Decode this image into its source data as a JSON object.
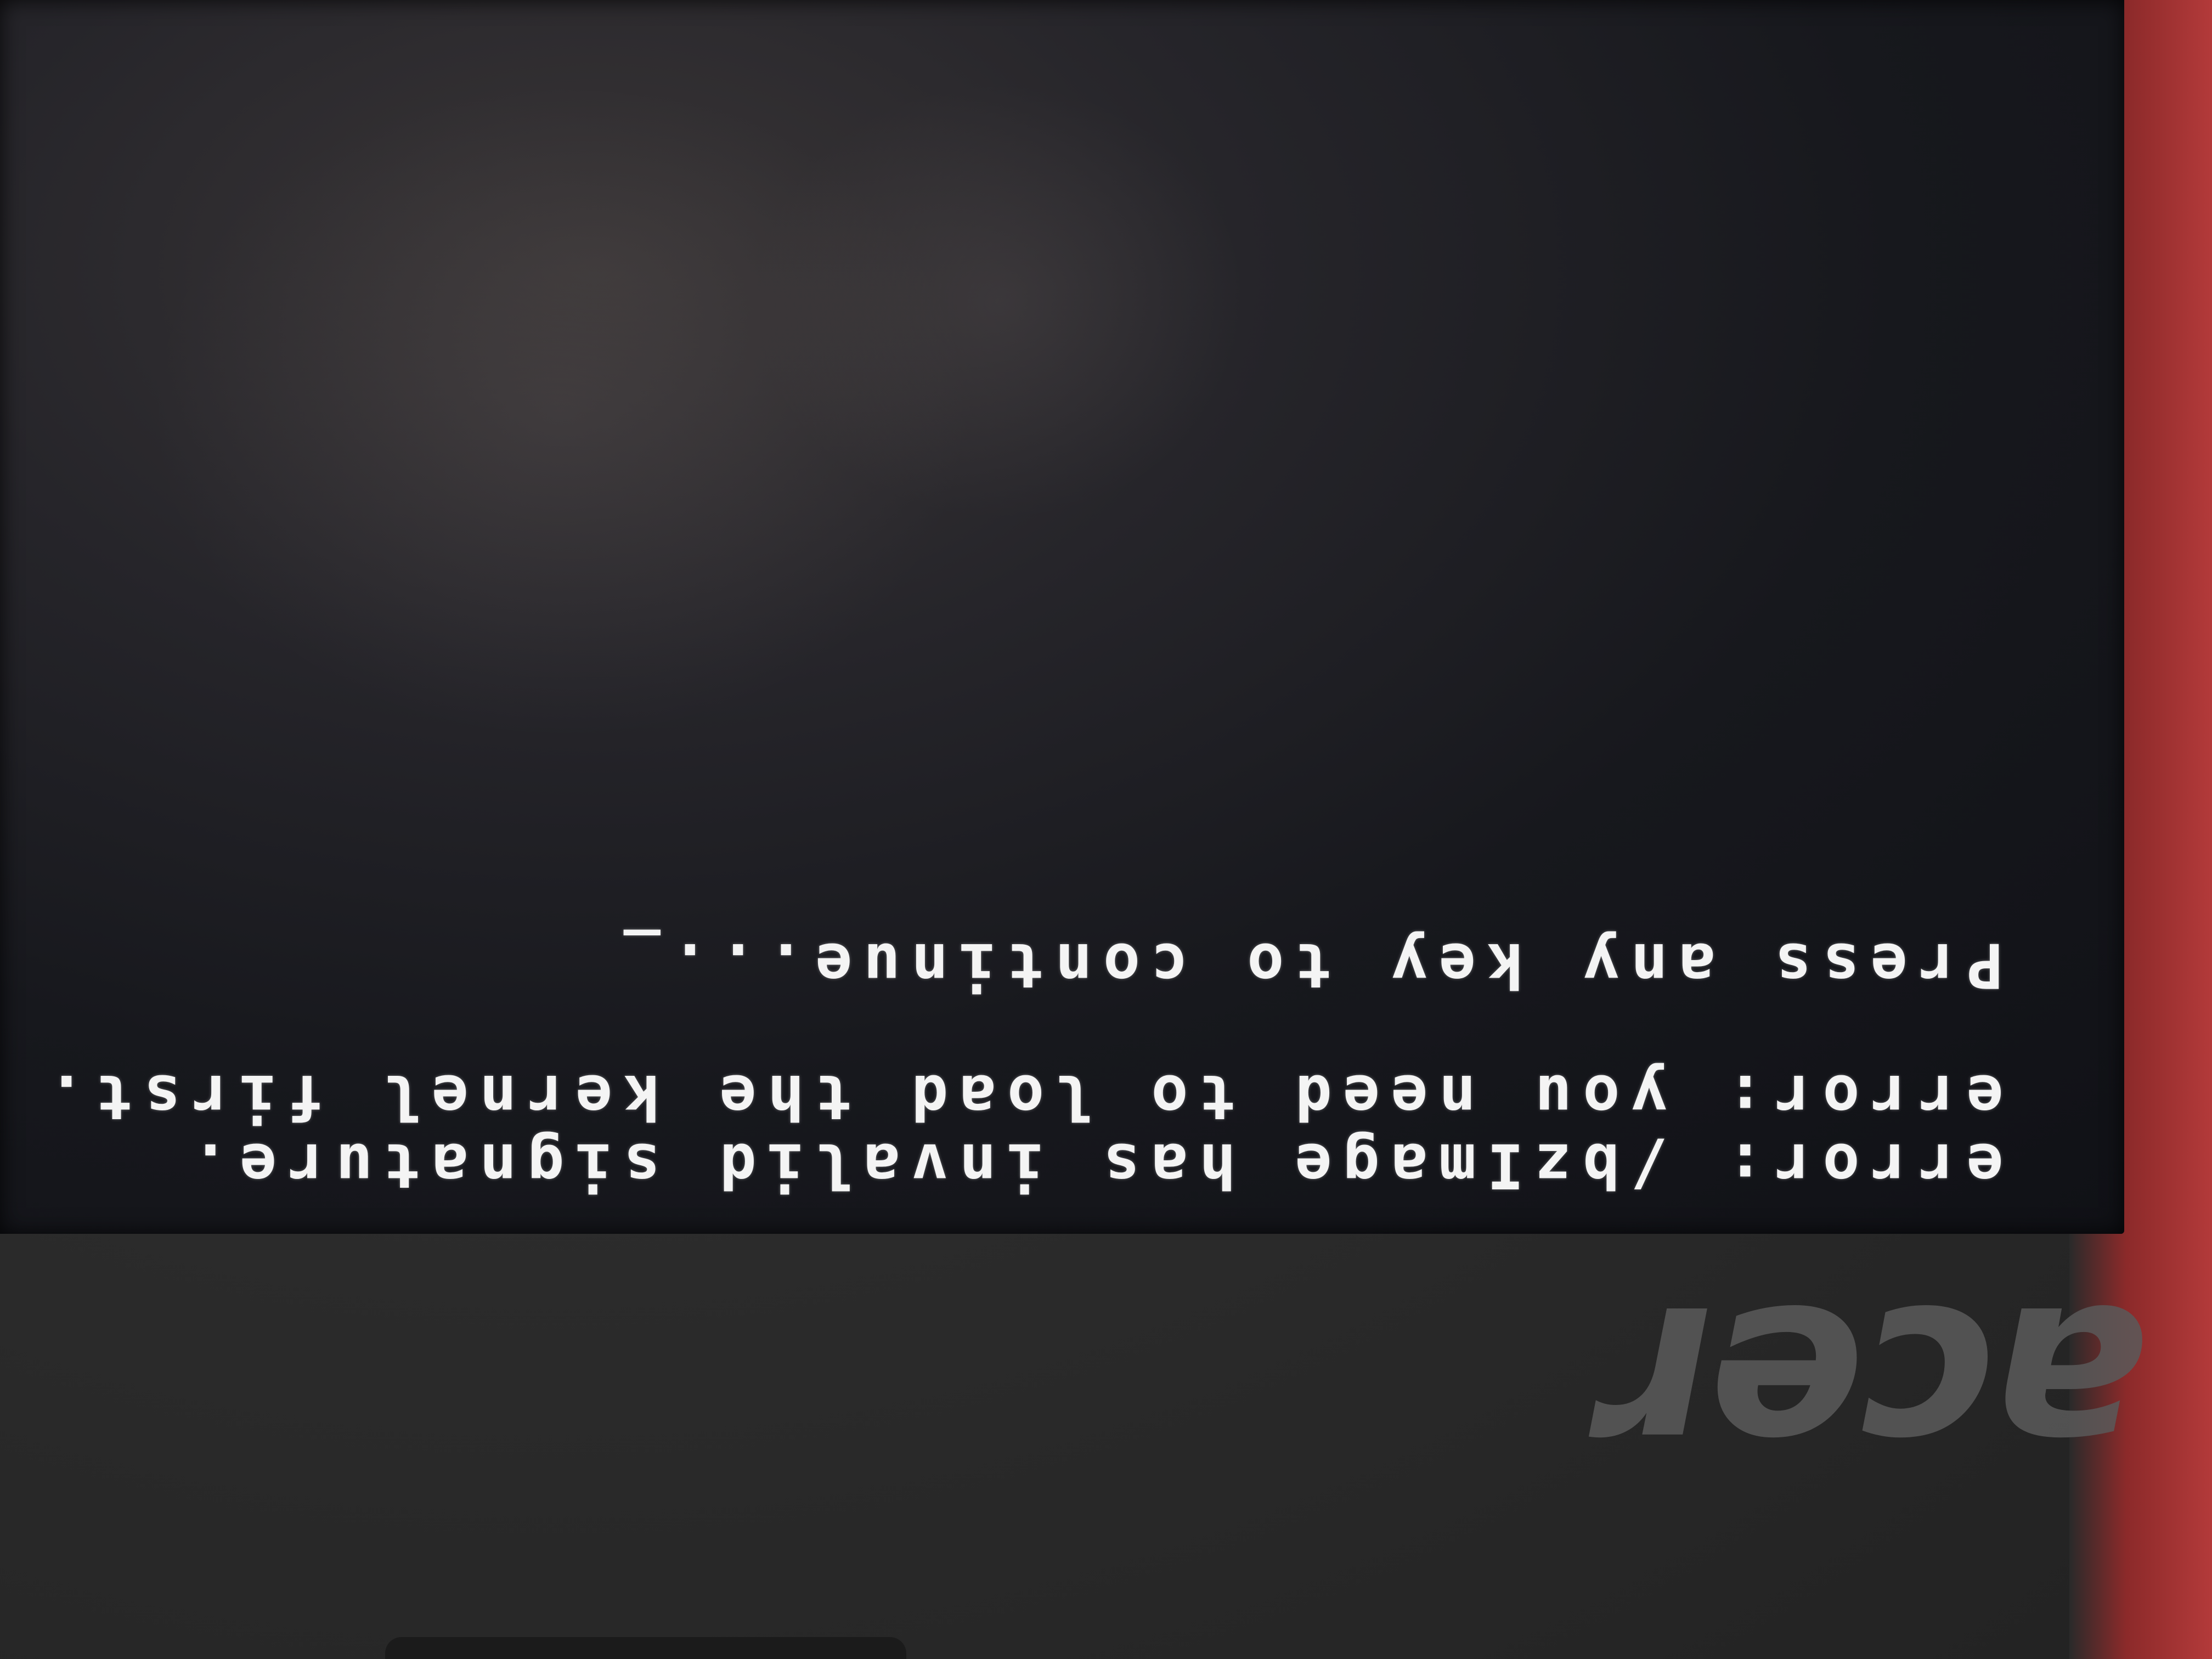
{
  "terminal": {
    "lines": [
      "error: /bzImage has invalid signature.",
      "error: you need to load the kernel first.",
      "Press any key to continue..._"
    ]
  },
  "bezel": {
    "brand_logo": "acer"
  },
  "colors": {
    "screen_background": "#15161b",
    "text": "#f4f4f4",
    "bezel": "#2b2b2b",
    "logo": "#5a5a5a"
  }
}
